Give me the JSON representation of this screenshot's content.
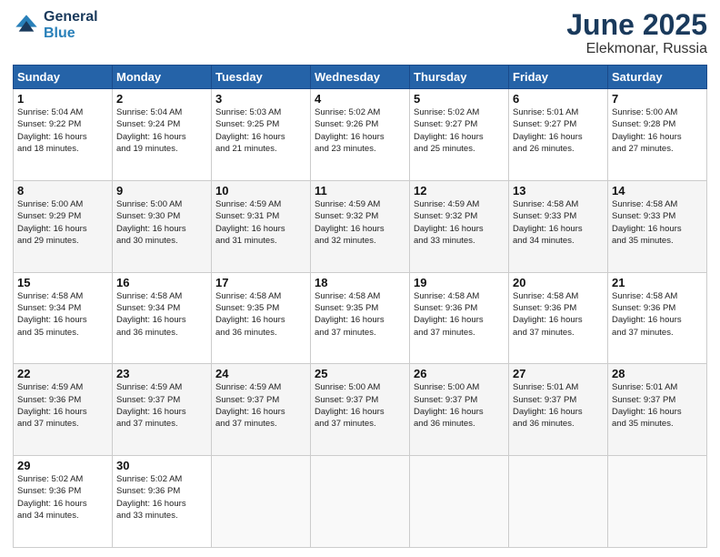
{
  "header": {
    "logo_line1": "General",
    "logo_line2": "Blue",
    "title": "June 2025",
    "subtitle": "Elekmonar, Russia"
  },
  "weekdays": [
    "Sunday",
    "Monday",
    "Tuesday",
    "Wednesday",
    "Thursday",
    "Friday",
    "Saturday"
  ],
  "weeks": [
    [
      {
        "day": "1",
        "info": "Sunrise: 5:04 AM\nSunset: 9:22 PM\nDaylight: 16 hours\nand 18 minutes."
      },
      {
        "day": "2",
        "info": "Sunrise: 5:04 AM\nSunset: 9:24 PM\nDaylight: 16 hours\nand 19 minutes."
      },
      {
        "day": "3",
        "info": "Sunrise: 5:03 AM\nSunset: 9:25 PM\nDaylight: 16 hours\nand 21 minutes."
      },
      {
        "day": "4",
        "info": "Sunrise: 5:02 AM\nSunset: 9:26 PM\nDaylight: 16 hours\nand 23 minutes."
      },
      {
        "day": "5",
        "info": "Sunrise: 5:02 AM\nSunset: 9:27 PM\nDaylight: 16 hours\nand 25 minutes."
      },
      {
        "day": "6",
        "info": "Sunrise: 5:01 AM\nSunset: 9:27 PM\nDaylight: 16 hours\nand 26 minutes."
      },
      {
        "day": "7",
        "info": "Sunrise: 5:00 AM\nSunset: 9:28 PM\nDaylight: 16 hours\nand 27 minutes."
      }
    ],
    [
      {
        "day": "8",
        "info": "Sunrise: 5:00 AM\nSunset: 9:29 PM\nDaylight: 16 hours\nand 29 minutes."
      },
      {
        "day": "9",
        "info": "Sunrise: 5:00 AM\nSunset: 9:30 PM\nDaylight: 16 hours\nand 30 minutes."
      },
      {
        "day": "10",
        "info": "Sunrise: 4:59 AM\nSunset: 9:31 PM\nDaylight: 16 hours\nand 31 minutes."
      },
      {
        "day": "11",
        "info": "Sunrise: 4:59 AM\nSunset: 9:32 PM\nDaylight: 16 hours\nand 32 minutes."
      },
      {
        "day": "12",
        "info": "Sunrise: 4:59 AM\nSunset: 9:32 PM\nDaylight: 16 hours\nand 33 minutes."
      },
      {
        "day": "13",
        "info": "Sunrise: 4:58 AM\nSunset: 9:33 PM\nDaylight: 16 hours\nand 34 minutes."
      },
      {
        "day": "14",
        "info": "Sunrise: 4:58 AM\nSunset: 9:33 PM\nDaylight: 16 hours\nand 35 minutes."
      }
    ],
    [
      {
        "day": "15",
        "info": "Sunrise: 4:58 AM\nSunset: 9:34 PM\nDaylight: 16 hours\nand 35 minutes."
      },
      {
        "day": "16",
        "info": "Sunrise: 4:58 AM\nSunset: 9:34 PM\nDaylight: 16 hours\nand 36 minutes."
      },
      {
        "day": "17",
        "info": "Sunrise: 4:58 AM\nSunset: 9:35 PM\nDaylight: 16 hours\nand 36 minutes."
      },
      {
        "day": "18",
        "info": "Sunrise: 4:58 AM\nSunset: 9:35 PM\nDaylight: 16 hours\nand 37 minutes."
      },
      {
        "day": "19",
        "info": "Sunrise: 4:58 AM\nSunset: 9:36 PM\nDaylight: 16 hours\nand 37 minutes."
      },
      {
        "day": "20",
        "info": "Sunrise: 4:58 AM\nSunset: 9:36 PM\nDaylight: 16 hours\nand 37 minutes."
      },
      {
        "day": "21",
        "info": "Sunrise: 4:58 AM\nSunset: 9:36 PM\nDaylight: 16 hours\nand 37 minutes."
      }
    ],
    [
      {
        "day": "22",
        "info": "Sunrise: 4:59 AM\nSunset: 9:36 PM\nDaylight: 16 hours\nand 37 minutes."
      },
      {
        "day": "23",
        "info": "Sunrise: 4:59 AM\nSunset: 9:37 PM\nDaylight: 16 hours\nand 37 minutes."
      },
      {
        "day": "24",
        "info": "Sunrise: 4:59 AM\nSunset: 9:37 PM\nDaylight: 16 hours\nand 37 minutes."
      },
      {
        "day": "25",
        "info": "Sunrise: 5:00 AM\nSunset: 9:37 PM\nDaylight: 16 hours\nand 37 minutes."
      },
      {
        "day": "26",
        "info": "Sunrise: 5:00 AM\nSunset: 9:37 PM\nDaylight: 16 hours\nand 36 minutes."
      },
      {
        "day": "27",
        "info": "Sunrise: 5:01 AM\nSunset: 9:37 PM\nDaylight: 16 hours\nand 36 minutes."
      },
      {
        "day": "28",
        "info": "Sunrise: 5:01 AM\nSunset: 9:37 PM\nDaylight: 16 hours\nand 35 minutes."
      }
    ],
    [
      {
        "day": "29",
        "info": "Sunrise: 5:02 AM\nSunset: 9:36 PM\nDaylight: 16 hours\nand 34 minutes."
      },
      {
        "day": "30",
        "info": "Sunrise: 5:02 AM\nSunset: 9:36 PM\nDaylight: 16 hours\nand 33 minutes."
      },
      {
        "day": "",
        "info": ""
      },
      {
        "day": "",
        "info": ""
      },
      {
        "day": "",
        "info": ""
      },
      {
        "day": "",
        "info": ""
      },
      {
        "day": "",
        "info": ""
      }
    ]
  ]
}
